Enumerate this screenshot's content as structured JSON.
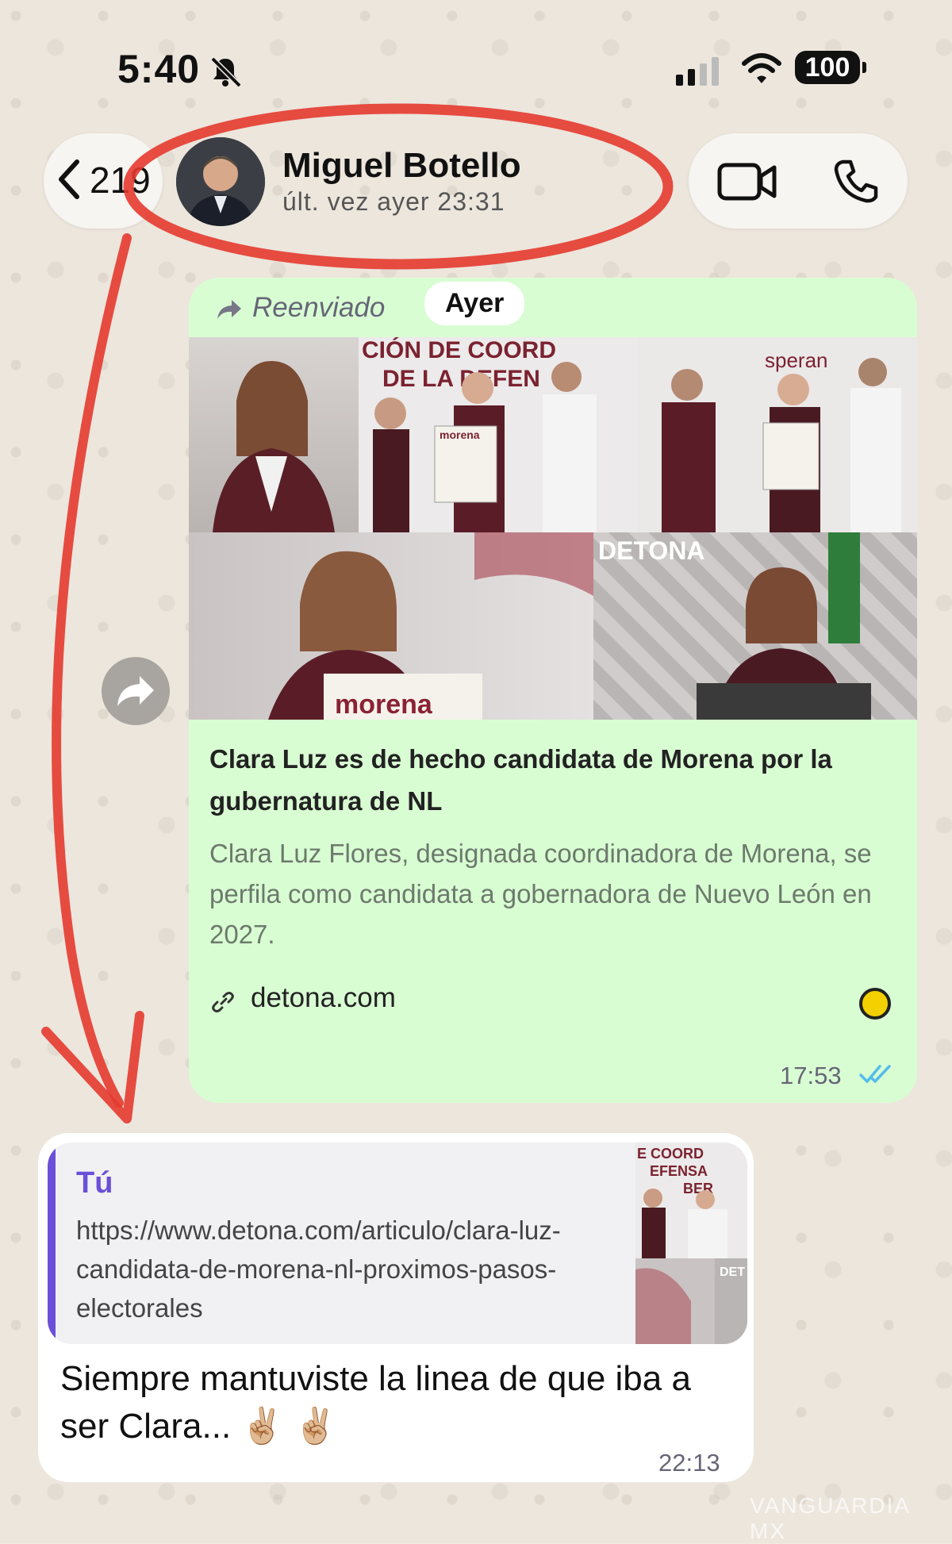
{
  "status_bar": {
    "time": "5:40",
    "battery": "100",
    "icons": [
      "bell-slash-icon",
      "signal-icon",
      "wifi-icon",
      "battery-icon"
    ]
  },
  "header": {
    "back_count": "219",
    "contact_name": "Miguel Botello",
    "contact_status": "últ. vez ayer 23:31",
    "actions": [
      "video-call-icon",
      "phone-icon"
    ]
  },
  "forwarded_message": {
    "forwarded_label": "Reenviado",
    "day_chip": "Ayer",
    "collage_texts": [
      "CIÓN DE COORD",
      "DE LA DEFEN",
      "morena",
      "DETONA",
      "speran"
    ],
    "link_title": "Clara Luz es de hecho candidata de Morena por la gubernatura de NL",
    "link_description": "Clara Luz Flores, designada coordinadora de Morena, se perfila como candidata a gobernadora de Nuevo León en 2027.",
    "link_domain": "detona.com",
    "time": "17:53"
  },
  "own_message": {
    "quote_author": "Tú",
    "quote_text": "https://www.detona.com/articulo/clara-luz-candidata-de-morena-nl-proximos-pasos-electorales",
    "quote_thumb_texts": [
      "E COORD",
      "EFENSA",
      "BER",
      "DET"
    ],
    "text": "Siempre mantuviste la linea de que iba a ser Clara... ✌🏼 ✌🏼",
    "time": "22:13"
  },
  "watermark": "VANGUARDIA MX",
  "colors": {
    "bubble_out_forwarded": "#d9fdd3",
    "bubble_own": "#ffffff",
    "quote_accent": "#6b4fd8",
    "read_ticks": "#53bdeb",
    "annotation_red": "#e53a2f"
  }
}
